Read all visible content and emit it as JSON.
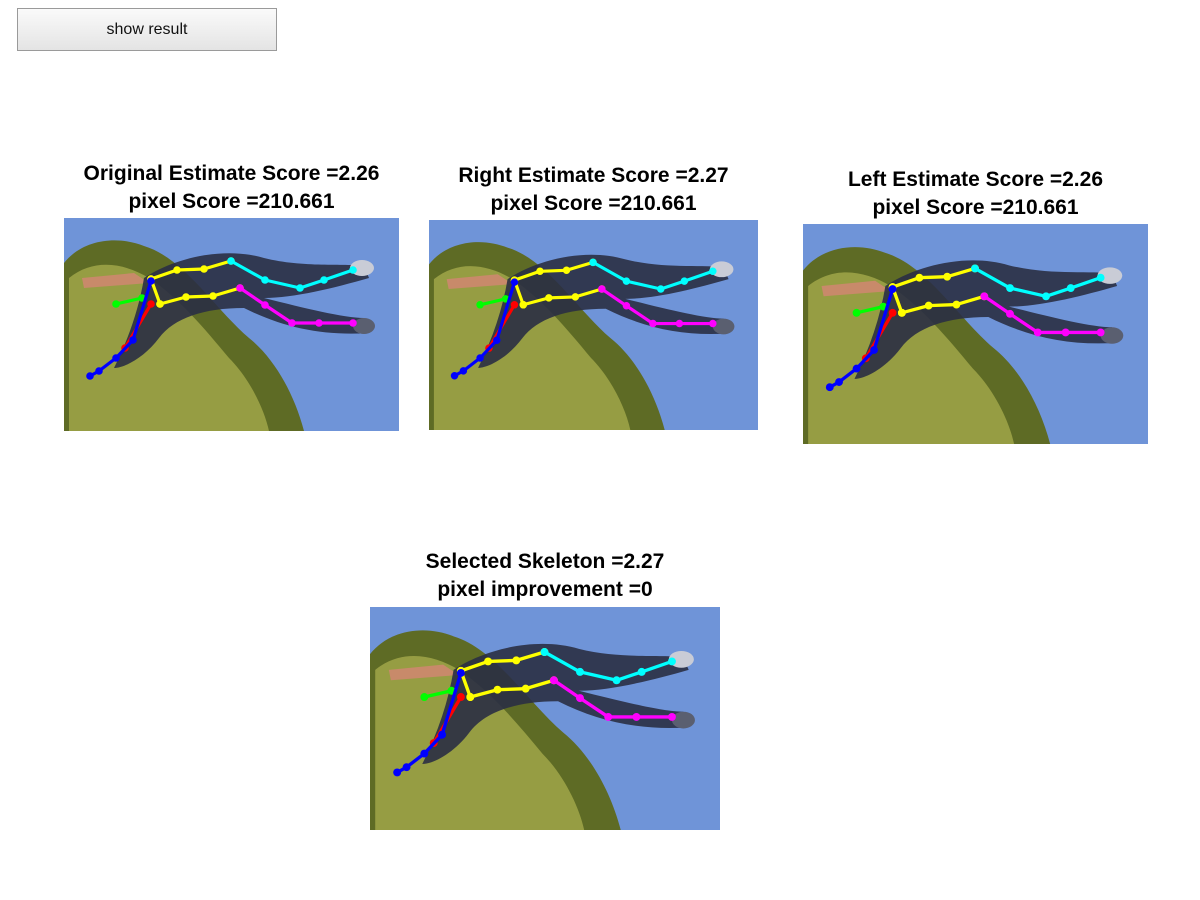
{
  "toolbar": {
    "show_result_label": "show result"
  },
  "panels": [
    {
      "line1": "Original Estimate Score =2.26",
      "line2": "pixel Score =210.661"
    },
    {
      "line1": "Right Estimate Score =2.27",
      "line2": "pixel Score =210.661"
    },
    {
      "line1": "Left Estimate Score =2.26",
      "line2": "pixel Score =210.661"
    },
    {
      "line1": "Selected Skeleton =2.27",
      "line2": "pixel improvement =0"
    }
  ],
  "colors": {
    "sky": "#6f94d8",
    "tree_dark": "#5e6b25",
    "tree_light": "#a9ae4d",
    "body": "#2a2f44",
    "torso": "#ffff00",
    "arm_right": "#00ffff",
    "leg_right": "#ff00ff",
    "arm_left_forearm": "#00ff00",
    "arm_left_upper": "#ff0000",
    "leg_left": "#0000ff"
  }
}
